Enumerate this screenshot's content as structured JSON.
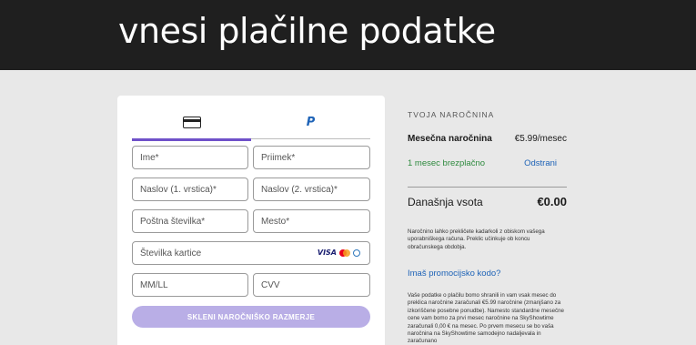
{
  "header": {
    "title": "vnesi plačilne podatke"
  },
  "payment_form": {
    "tabs": [
      {
        "name": "card",
        "icon": "credit-card-icon",
        "active": true
      },
      {
        "name": "paypal",
        "icon": "paypal-icon",
        "active": false
      }
    ],
    "paypal_logo": "P",
    "fields": {
      "first_name": "Ime*",
      "last_name": "Priimek*",
      "address1": "Naslov (1. vrstica)*",
      "address2": "Naslov (2. vrstica)*",
      "postal_code": "Poštna številka*",
      "city": "Mesto*",
      "card_number": "Številka kartice",
      "expiry": "MM/LL",
      "cvv": "CVV"
    },
    "card_brand_visa": "VISA",
    "submit_label": "SKLENI NAROČNIŠKO RAZMERJE",
    "accent_color": "#6f51c9"
  },
  "summary": {
    "title": "TVOJA NAROČNINA",
    "plan_name": "Mesečna naročnina",
    "plan_price": "€5.99/mesec",
    "free_trial": "1 mesec brezplačno",
    "remove_label": "Odstrani",
    "total_label": "Današnja vsota",
    "total_amount": "€0.00",
    "cancel_note": "Naročnino lahko prekličete kadarkoli z obiskom vašega uporabniškega računa. Preklic učinkuje ob koncu obračunskega obdobja.",
    "promo_link": "Imaš promocijsko kodo?",
    "legal_text": "Vaše podatke o plačilu bomo shranili in vam vsak mesec do preklica naročnine zaračunali €5.99 naročnine (zmanjšano za izkoriščene posebne ponudbe). Namesto standardne mesečne cene vam bomo za prvi mesec naročnine na SkyShowtime zaračunali 0,00 € na mesec. Po prvem mesecu se bo vaša naročnina na SkyShowtime samodejno nadaljevala in zaračunano"
  }
}
